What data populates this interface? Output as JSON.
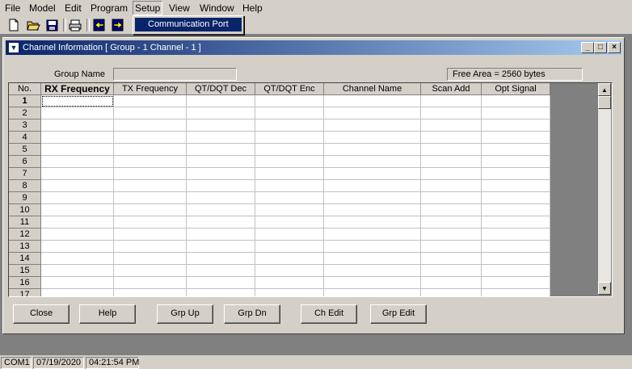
{
  "menu": [
    "File",
    "Model",
    "Edit",
    "Program",
    "Setup",
    "View",
    "Window",
    "Help"
  ],
  "setup_menu": {
    "item": "Communication Port"
  },
  "toolbar": {
    "icons": [
      "new-file-icon",
      "open-folder-icon",
      "save-icon",
      "print-icon",
      "read-radio-icon",
      "write-radio-icon"
    ]
  },
  "window": {
    "title": "Channel Information [ Group - 1  Channel - 1 ]"
  },
  "form": {
    "group_name_label": "Group Name",
    "group_name_value": "",
    "free_area": "Free Area = 2560 bytes"
  },
  "grid": {
    "columns": [
      "No.",
      "RX Frequency",
      "TX Frequency",
      "QT/DQT Dec",
      "QT/DQT Enc",
      "Channel Name",
      "Scan Add",
      "Opt Signal"
    ],
    "rows": [
      "1",
      "2",
      "3",
      "4",
      "5",
      "6",
      "7",
      "8",
      "9",
      "10",
      "11",
      "12",
      "13",
      "14",
      "15",
      "16",
      "17"
    ]
  },
  "buttons": {
    "close": "Close",
    "help": "Help",
    "grp_up": "Grp Up",
    "grp_dn": "Grp Dn",
    "ch_edit": "Ch Edit",
    "grp_edit": "Grp Edit"
  },
  "status": {
    "port": "COM1",
    "date": "07/19/2020",
    "time": "04:21:54 PM"
  },
  "colors": {
    "face": "#d4d0c8",
    "title_start": "#0a246a",
    "title_end": "#a6caf0",
    "highlight": "#0a246a"
  }
}
